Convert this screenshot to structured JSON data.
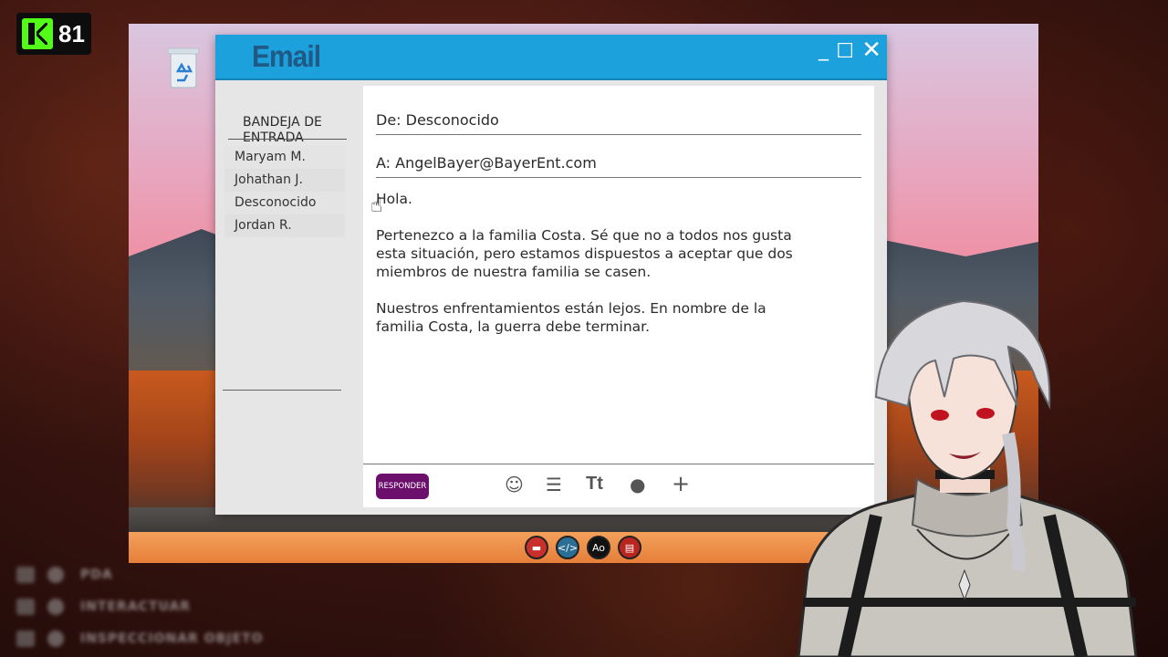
{
  "stream": {
    "viewer_count": "81",
    "platform_icon": "kick-logo-icon"
  },
  "desktop": {
    "recycle_bin_icon": "recycle-bin-icon",
    "taskbar_apps": [
      {
        "icon": "presentation-app-icon",
        "glyph": "▬"
      },
      {
        "icon": "code-editor-icon",
        "glyph": "</>"
      },
      {
        "icon": "font-app-icon",
        "glyph": "Ao"
      },
      {
        "icon": "browser-app-icon",
        "glyph": "▤"
      }
    ]
  },
  "email_window": {
    "title": "Email",
    "controls": {
      "minimize": "_",
      "maximize": "☐",
      "close": "✕"
    },
    "sidebar": {
      "inbox_title": "BANDEJA DE ENTRADA",
      "items": [
        "Maryam M.",
        "Johathan J.",
        "Desconocido",
        "Jordan R."
      ]
    },
    "message": {
      "from": "De: Desconocido",
      "to": "A: AngelBayer@BayerEnt.com",
      "greeting": "Hola.",
      "paragraph1": "Pertenezco a la familia Costa. Sé que no a todos nos gusta esta situación, pero estamos dispuestos a aceptar que dos miembros de nuestra familia se casen.",
      "paragraph2": "Nuestros enfrentamientos están lejos. En nombre de la familia Costa, la guerra debe terminar."
    },
    "compose": {
      "reply_label": "RESPONDER",
      "tools": [
        "emoji-icon",
        "align-icon",
        "text-size-icon",
        "color-icon",
        "add-icon"
      ]
    }
  },
  "hud": {
    "actions": [
      "PDA",
      "INTERACTUAR",
      "INSPECCIONAR OBJETO"
    ]
  },
  "colors": {
    "titlebar": "#1ca1dc",
    "reply_button": "#6c0f6c",
    "kick_green": "#53fc18",
    "taskbar": "#e57f3a"
  }
}
